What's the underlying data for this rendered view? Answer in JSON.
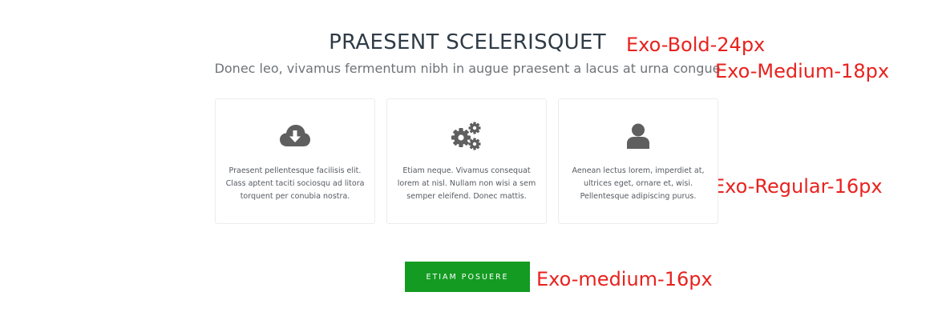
{
  "section": {
    "title": "PRAESENT SCELERISQUET",
    "subtitle": "Donec leo, vivamus fermentum nibh in augue praesent a lacus at urna congue"
  },
  "annotations": {
    "title_font": "Exo-Bold-24px",
    "subtitle_font": "Exo-Medium-18px",
    "body_font": "Exo-Regular-16px",
    "button_font": "Exo-medium-16px",
    "color": "#e8221e"
  },
  "cards": [
    {
      "icon": "cloud-download-icon",
      "lines": [
        "Praesent pellentesque facilisis elit.",
        "Class aptent taciti sociosqu ad litora",
        "torquent per conubia nostra."
      ]
    },
    {
      "icon": "gears-icon",
      "lines": [
        "Etiam neque. Vivamus consequat",
        "lorem at nisl. Nullam non wisi a sem",
        "semper eleifend. Donec mattis."
      ]
    },
    {
      "icon": "user-icon",
      "lines": [
        "Aenean lectus lorem, imperdiet at,",
        "ultrices eget, ornare et, wisi.",
        "Pellentesque adipiscing purus."
      ]
    }
  ],
  "cta": {
    "label": "ETIAM POSUERE",
    "color": "#149b22"
  },
  "colors": {
    "heading": "#2f3b46",
    "subheading": "#6f7378",
    "icon": "#5f5f5f",
    "card_border": "#ececec"
  }
}
